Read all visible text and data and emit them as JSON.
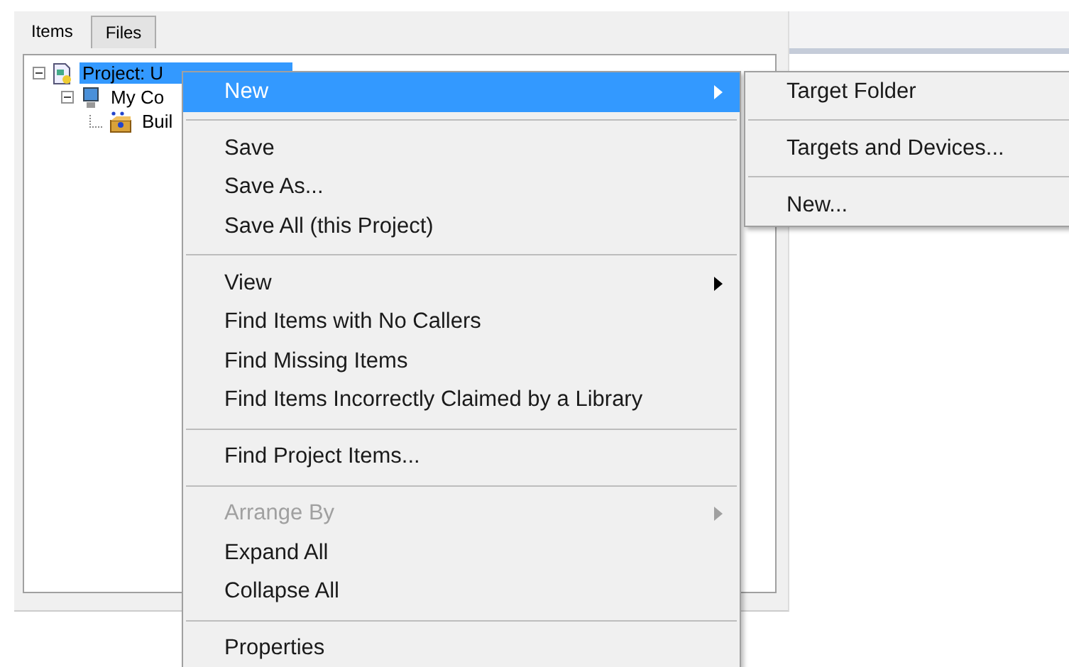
{
  "tabs": [
    {
      "label": "Items",
      "selected": true
    },
    {
      "label": "Files",
      "selected": false
    }
  ],
  "tree": [
    {
      "label": "Project: U",
      "selected": true,
      "expanded": true,
      "children": [
        {
          "label": "My Co",
          "selected": false,
          "expanded": true,
          "children": [
            {
              "label": "Buil",
              "selected": false
            }
          ]
        }
      ]
    }
  ],
  "context_menu": [
    {
      "kind": "item",
      "label": "New",
      "submenu": true,
      "selected": true,
      "disabled": false
    },
    {
      "kind": "separator"
    },
    {
      "kind": "item",
      "label": "Save",
      "submenu": false,
      "selected": false,
      "disabled": false
    },
    {
      "kind": "item",
      "label": "Save As...",
      "submenu": false,
      "selected": false,
      "disabled": false
    },
    {
      "kind": "item",
      "label": "Save All (this Project)",
      "submenu": false,
      "selected": false,
      "disabled": false
    },
    {
      "kind": "separator"
    },
    {
      "kind": "item",
      "label": "View",
      "submenu": true,
      "selected": false,
      "disabled": false
    },
    {
      "kind": "item",
      "label": "Find Items with No Callers",
      "submenu": false,
      "selected": false,
      "disabled": false
    },
    {
      "kind": "item",
      "label": "Find Missing Items",
      "submenu": false,
      "selected": false,
      "disabled": false
    },
    {
      "kind": "item",
      "label": "Find Items Incorrectly Claimed by a Library",
      "submenu": false,
      "selected": false,
      "disabled": false
    },
    {
      "kind": "separator"
    },
    {
      "kind": "item",
      "label": "Find Project Items...",
      "submenu": false,
      "selected": false,
      "disabled": false
    },
    {
      "kind": "separator"
    },
    {
      "kind": "item",
      "label": "Arrange By",
      "submenu": true,
      "selected": false,
      "disabled": true
    },
    {
      "kind": "item",
      "label": "Expand All",
      "submenu": false,
      "selected": false,
      "disabled": false
    },
    {
      "kind": "item",
      "label": "Collapse All",
      "submenu": false,
      "selected": false,
      "disabled": false
    },
    {
      "kind": "separator"
    },
    {
      "kind": "item",
      "label": "Properties",
      "submenu": false,
      "selected": false,
      "disabled": false
    }
  ],
  "submenu": [
    {
      "kind": "item",
      "label": "Target Folder"
    },
    {
      "kind": "separator"
    },
    {
      "kind": "item",
      "label": "Targets and Devices..."
    },
    {
      "kind": "separator"
    },
    {
      "kind": "item",
      "label": "New..."
    }
  ]
}
